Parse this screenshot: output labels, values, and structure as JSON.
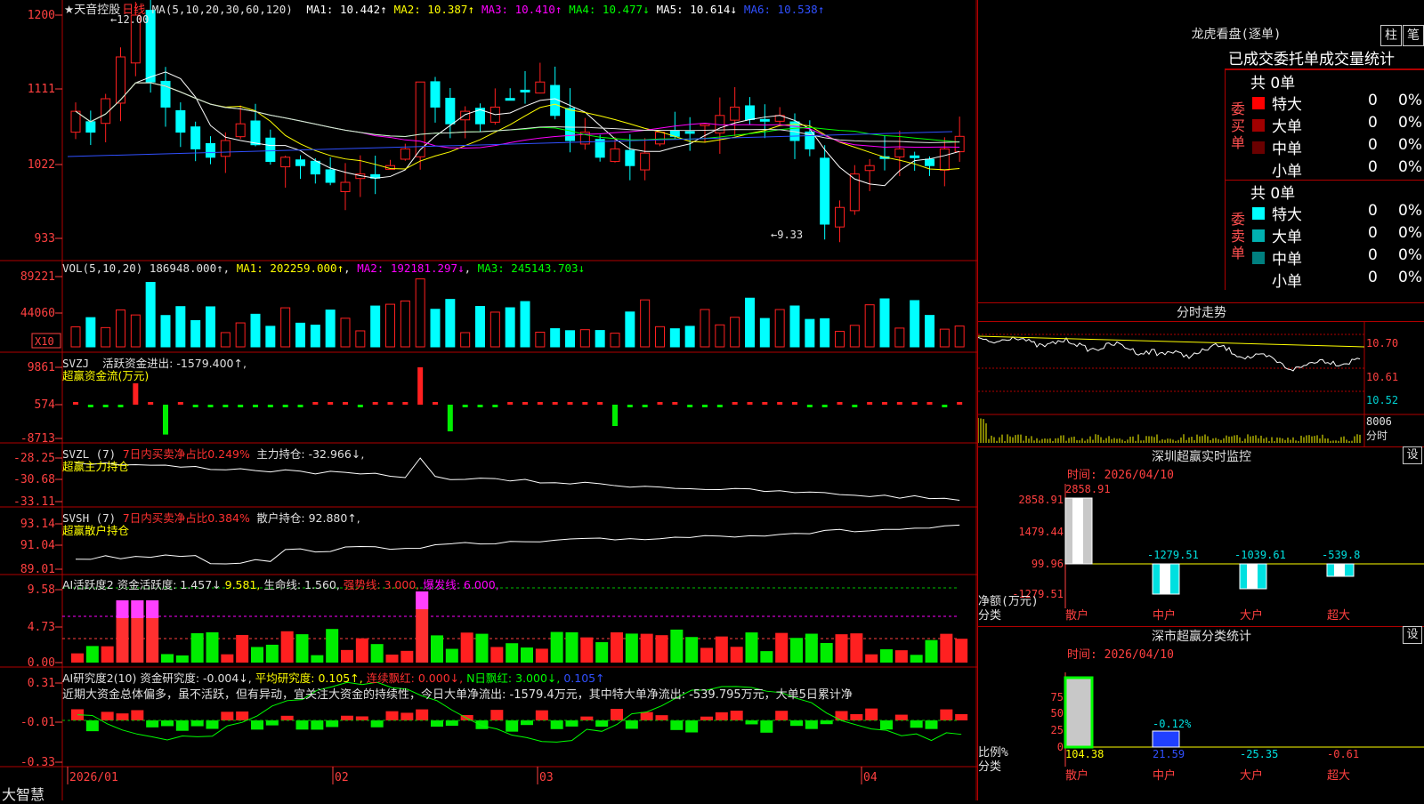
{
  "stock": {
    "star": "★",
    "name": "天音控股",
    "period": "日线"
  },
  "ma_line": {
    "label": "MA(5,10,20,30,60,120)",
    "items": [
      {
        "text": "MA1: 10.442↑",
        "color": "#ffffff"
      },
      {
        "text": "MA2: 10.387↑",
        "color": "#ffff00"
      },
      {
        "text": "MA3: 10.410↑",
        "color": "#ff00ff"
      },
      {
        "text": "MA4: 10.477↓",
        "color": "#00ff00"
      },
      {
        "text": "MA5: 10.614↓",
        "color": "#ffffff"
      },
      {
        "text": "MA6: 10.538↑",
        "color": "#3050ff"
      }
    ]
  },
  "price_axis": [
    "1200",
    "1111",
    "1022",
    "933"
  ],
  "annot": {
    "high": "←12.00",
    "low": "←9.33"
  },
  "vol": {
    "label": "VOL(5,10,20)",
    "value": "186948.000↑",
    "ma1": "MA1: 202259.000↑",
    "ma2": "MA2: 192181.297↓",
    "ma3": "MA3: 245143.703↓",
    "axis": [
      "89221",
      "44060"
    ],
    "unit": "X10"
  },
  "svzj": {
    "label": "SVZJ",
    "text": "活跃资金进出: -1579.400↑,",
    "sub": "超赢资金流(万元)",
    "axis": [
      "9861",
      "574",
      "-8713"
    ]
  },
  "svzl": {
    "label": "SVZL (7)",
    "t1": "7日内买卖净占比0.249%",
    "t2": "主力持仓: -32.966↓,",
    "sub": "超赢主力持仓",
    "axis": [
      "-28.25",
      "-30.68",
      "-33.11"
    ]
  },
  "svsh": {
    "label": "SVSH (7)",
    "t1": "7日内买卖净占比0.384%",
    "t2": "散户持仓: 92.880↑,",
    "sub": "超赢散户持仓",
    "axis": [
      "93.14",
      "91.04",
      "89.01"
    ]
  },
  "ai1": {
    "label": "AI活跃度2",
    "t1": "资金活跃度: 1.457↓",
    "t2": "9.581,",
    "t3": "生命线: 1.560,",
    "t4": "强势线: 3.000,",
    "t5": "爆发线: 6.000,",
    "axis": [
      "9.58",
      "4.73",
      "0.00"
    ]
  },
  "ai2": {
    "label": "AI研究度2(10)",
    "t1": "资金研究度: -0.004↓,",
    "t2": "平均研究度: 0.105↑,",
    "t3": "连续飘红: 0.000↓,",
    "t4": "N日飘红: 3.000↓,",
    "t5": "0.105↑",
    "desc": "近期大资金总体偏多，虽不活跃，但有异动，宜关注大资金的持续性，今日大单净流出: -1579.4万元，其中特大单净流出: -539.795万元，大单5日累计净",
    "axis": [
      "0.31",
      "-0.01",
      "-0.33"
    ]
  },
  "dates": [
    "2026/01",
    "02",
    "03",
    "04"
  ],
  "brand": "大智慧",
  "lhb": {
    "title": "龙虎看盘(逐单)",
    "btn1": "柱",
    "btn2": "笔",
    "tab": "已成交委托单成交量统计",
    "buy_label": "委买单",
    "sell_label": "委卖单",
    "total_buy": "共 0单",
    "total_sell": "共 0单",
    "buy_rows": [
      {
        "name": "特大",
        "v": "0",
        "p": "0%",
        "color": "#ff0000"
      },
      {
        "name": "大单",
        "v": "0",
        "p": "0%",
        "color": "#a00000"
      },
      {
        "name": "中单",
        "v": "0",
        "p": "0%",
        "color": "#6a0000"
      },
      {
        "name": "小单",
        "v": "0",
        "p": "0%",
        "color": "#000000"
      }
    ],
    "sell_rows": [
      {
        "name": "特大",
        "v": "0",
        "p": "0%",
        "color": "#00ffff"
      },
      {
        "name": "大单",
        "v": "0",
        "p": "0%",
        "color": "#00b0b0"
      },
      {
        "name": "中单",
        "v": "0",
        "p": "0%",
        "color": "#008080"
      },
      {
        "name": "小单",
        "v": "0",
        "p": "0%",
        "color": "#000000"
      }
    ]
  },
  "fenshi": {
    "title": "分时走势",
    "axis": [
      "10.70",
      "10.61",
      "10.52"
    ],
    "vol": "8006",
    "vol_unit": "分时"
  },
  "sz": {
    "title": "深圳超赢实时监控",
    "set": "设",
    "time": "时间: 2026/04/10",
    "axis": [
      "2858.91",
      "1479.44",
      "99.96",
      "-1279.51"
    ],
    "ylabel": "净额(万元)",
    "xlabel": "分类",
    "cats": [
      "散户",
      "中户",
      "大户",
      "超大"
    ],
    "vals": [
      "2858.91",
      "-1279.51",
      "-1039.61",
      "-539.8"
    ]
  },
  "fl": {
    "title": "深市超赢分类统计",
    "set": "设",
    "time": "时间: 2026/04/10",
    "axis": [
      "75",
      "50",
      "25",
      "0"
    ],
    "ylabel": "比例%",
    "xlabel": "分类",
    "cats": [
      "散户",
      "中户",
      "大户",
      "超大"
    ],
    "vals": [
      "104.38",
      "21.59",
      "-25.35",
      "-0.61"
    ],
    "annot": "-0.12%"
  },
  "colors": {
    "up": "#ff2020",
    "down": "#00ffff",
    "grid": "#b00000",
    "axis": "#ff4040"
  }
}
